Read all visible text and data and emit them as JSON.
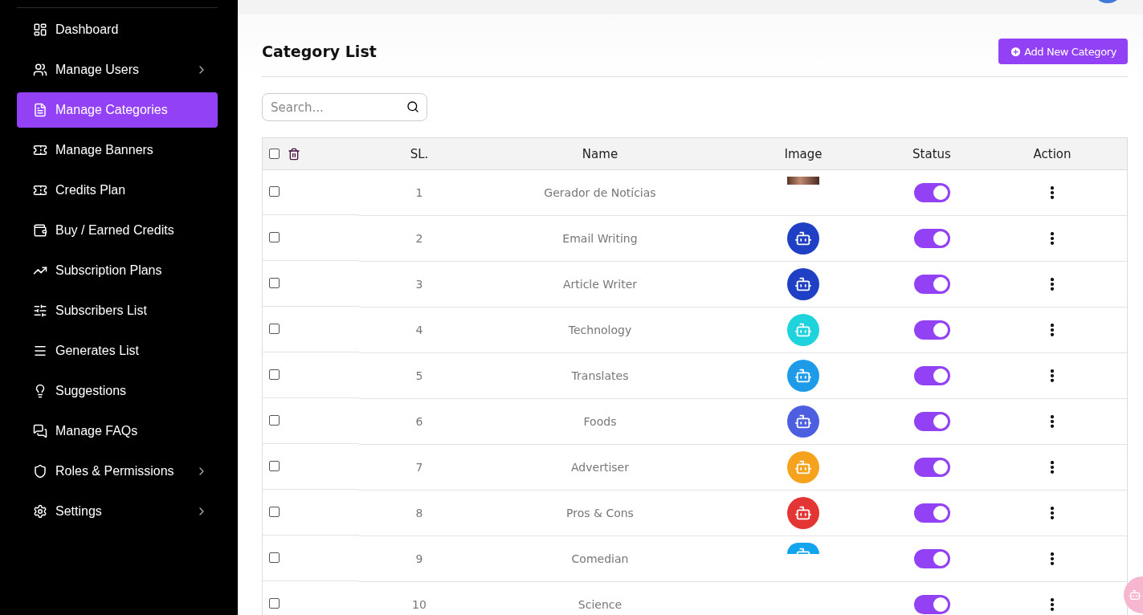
{
  "sidebar": {
    "items": [
      {
        "label": "Dashboard",
        "selected": false,
        "has_submenu": false
      },
      {
        "label": "Manage Users",
        "selected": false,
        "has_submenu": true
      },
      {
        "label": "Manage Categories",
        "selected": true,
        "has_submenu": false
      },
      {
        "label": "Manage Banners",
        "selected": false,
        "has_submenu": false
      },
      {
        "label": "Credits Plan",
        "selected": false,
        "has_submenu": false
      },
      {
        "label": "Buy / Earned Credits",
        "selected": false,
        "has_submenu": false
      },
      {
        "label": "Subscription Plans",
        "selected": false,
        "has_submenu": false
      },
      {
        "label": "Subscribers List",
        "selected": false,
        "has_submenu": false
      },
      {
        "label": "Generates List",
        "selected": false,
        "has_submenu": false
      },
      {
        "label": "Suggestions",
        "selected": false,
        "has_submenu": false
      },
      {
        "label": "Manage FAQs",
        "selected": false,
        "has_submenu": false
      },
      {
        "label": "Roles & Permissions",
        "selected": false,
        "has_submenu": true
      },
      {
        "label": "Settings",
        "selected": false,
        "has_submenu": true
      }
    ]
  },
  "page": {
    "title": "Category List",
    "add_button": "Add New Category",
    "search": {
      "placeholder": "Search..."
    }
  },
  "table": {
    "columns": [
      "SL.",
      "Name",
      "Image",
      "Status",
      "Action"
    ],
    "select_all_checked": false,
    "rows": [
      {
        "checked": false,
        "sl": "1",
        "name": "Gerador de Notícias",
        "image": {
          "kind": "photo-strip"
        },
        "on": true
      },
      {
        "checked": false,
        "sl": "2",
        "name": "Email Writing",
        "image": {
          "kind": "robot",
          "color": "#1f3fc4"
        },
        "on": true
      },
      {
        "checked": false,
        "sl": "3",
        "name": "Article Writer",
        "image": {
          "kind": "robot",
          "color": "#1f3fc4"
        },
        "on": true
      },
      {
        "checked": false,
        "sl": "4",
        "name": "Technology",
        "image": {
          "kind": "robot",
          "color": "#1fd3dc"
        },
        "on": true
      },
      {
        "checked": false,
        "sl": "5",
        "name": "Translates",
        "image": {
          "kind": "robot",
          "color": "#1e9be8"
        },
        "on": true
      },
      {
        "checked": false,
        "sl": "6",
        "name": "Foods",
        "image": {
          "kind": "robot",
          "color": "#4b5fe0"
        },
        "on": true
      },
      {
        "checked": false,
        "sl": "7",
        "name": "Advertiser",
        "image": {
          "kind": "robot",
          "color": "#f5a21c"
        },
        "on": true
      },
      {
        "checked": false,
        "sl": "8",
        "name": "Pros & Cons",
        "image": {
          "kind": "robot",
          "color": "#e43535"
        },
        "on": true
      },
      {
        "checked": false,
        "sl": "9",
        "name": "Comedian",
        "image": {
          "kind": "robot-cropped",
          "color": "#13a4ee"
        },
        "on": true
      },
      {
        "checked": false,
        "sl": "10",
        "name": "Science",
        "on": true
      }
    ]
  }
}
